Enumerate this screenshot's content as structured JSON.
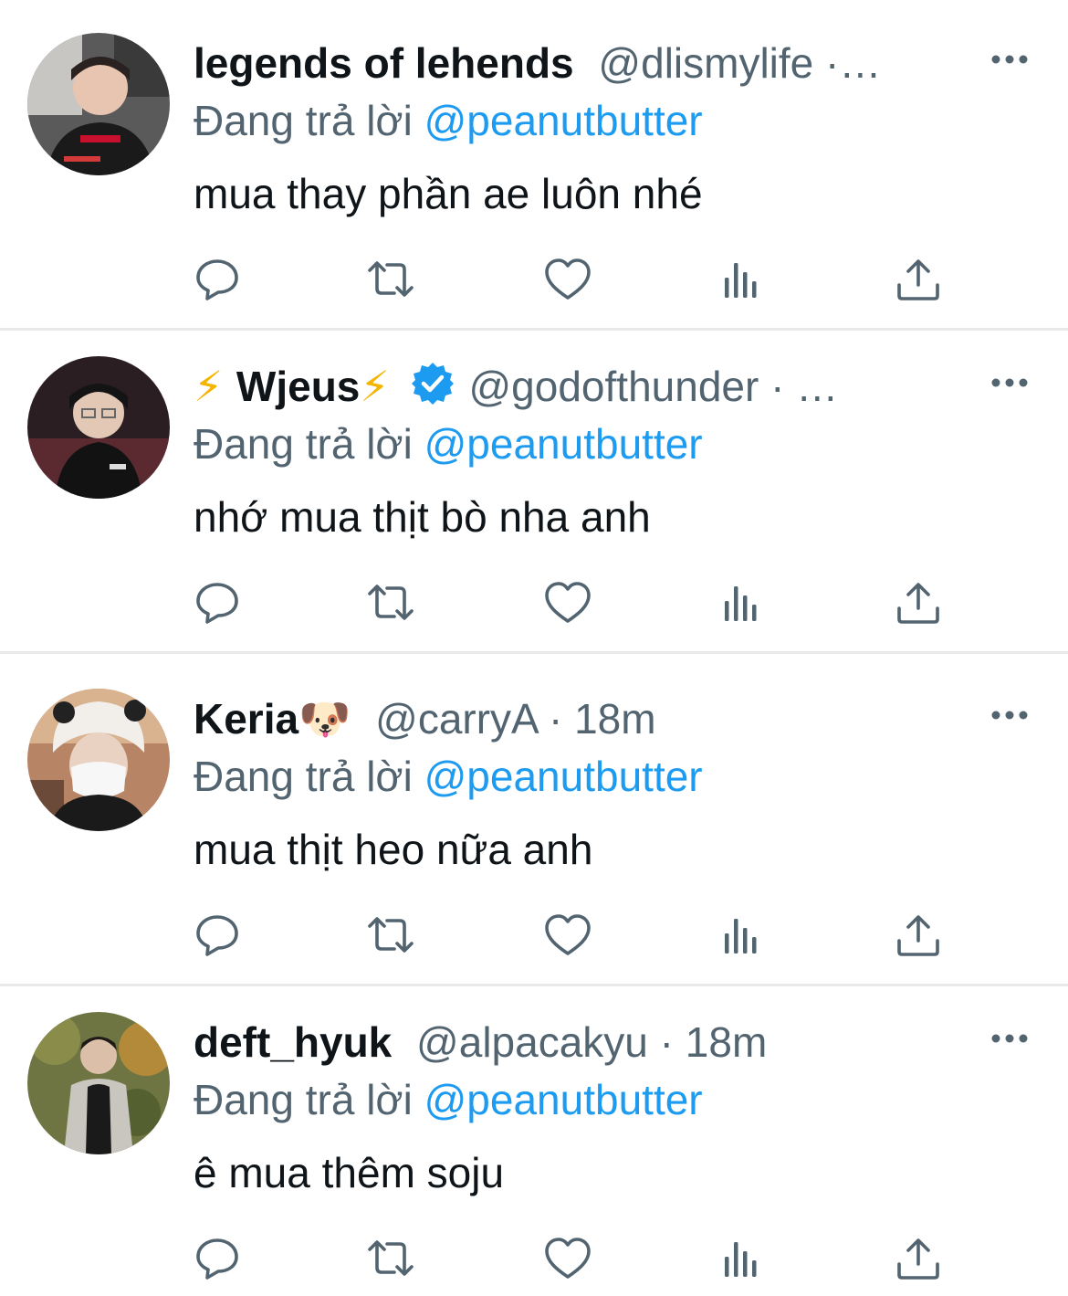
{
  "reply_prefix": "Đang trả lời",
  "tweets": [
    {
      "display_name": "legends of lehends",
      "name_emoji_before": "",
      "name_emoji_after": "",
      "verified": false,
      "handle": "@dlismylife",
      "separator": " ·…",
      "time": "",
      "reply_to": "@peanutbutter",
      "text": "mua thay phần ae luôn nhé"
    },
    {
      "display_name": "Wjeus",
      "name_emoji_before": "⚡ ",
      "name_emoji_after": "⚡",
      "verified": true,
      "handle": "@godofthunder",
      "separator": " · …",
      "time": "",
      "reply_to": "@peanutbutter",
      "text": "nhớ mua thịt bò nha anh"
    },
    {
      "display_name": "Keria",
      "name_emoji_before": "",
      "name_emoji_after": "🐶",
      "verified": false,
      "handle": "@carryA",
      "separator": " · ",
      "time": "18m",
      "reply_to": "@peanutbutter",
      "text": "mua thịt heo nữa anh"
    },
    {
      "display_name": "deft_hyuk",
      "name_emoji_before": "",
      "name_emoji_after": "",
      "verified": false,
      "handle": "@alpacakyu",
      "separator": " · ",
      "time": "18m",
      "reply_to": "@peanutbutter",
      "text": "ê mua thêm soju"
    }
  ],
  "icons": {
    "more": "more-horizontal-icon",
    "reply": "reply-bubble-icon",
    "retweet": "retweet-icon",
    "like": "heart-icon",
    "views": "views-bars-icon",
    "share": "share-upload-icon",
    "verified": "verified-badge-icon"
  },
  "colors": {
    "text": "#0f1419",
    "secondary": "#536471",
    "link": "#1d9bf0",
    "verified": "#1d9bf0",
    "divider": "#e7e9ea"
  }
}
